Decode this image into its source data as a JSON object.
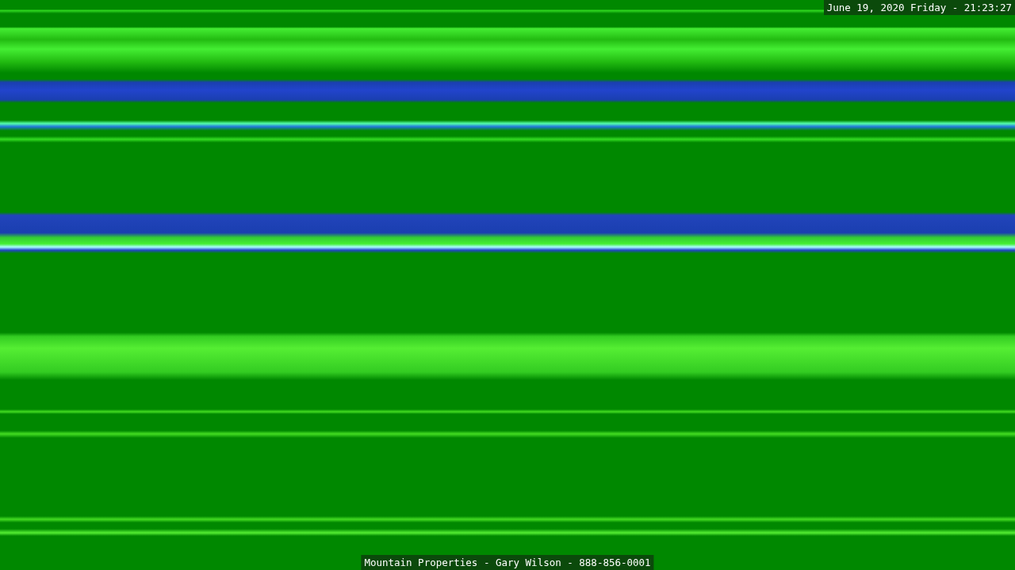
{
  "overlay": {
    "timestamp": "June 19, 2020 Friday - 21:23:27",
    "caption": "Mountain Properties - Gary Wilson - 888-856-0001"
  }
}
